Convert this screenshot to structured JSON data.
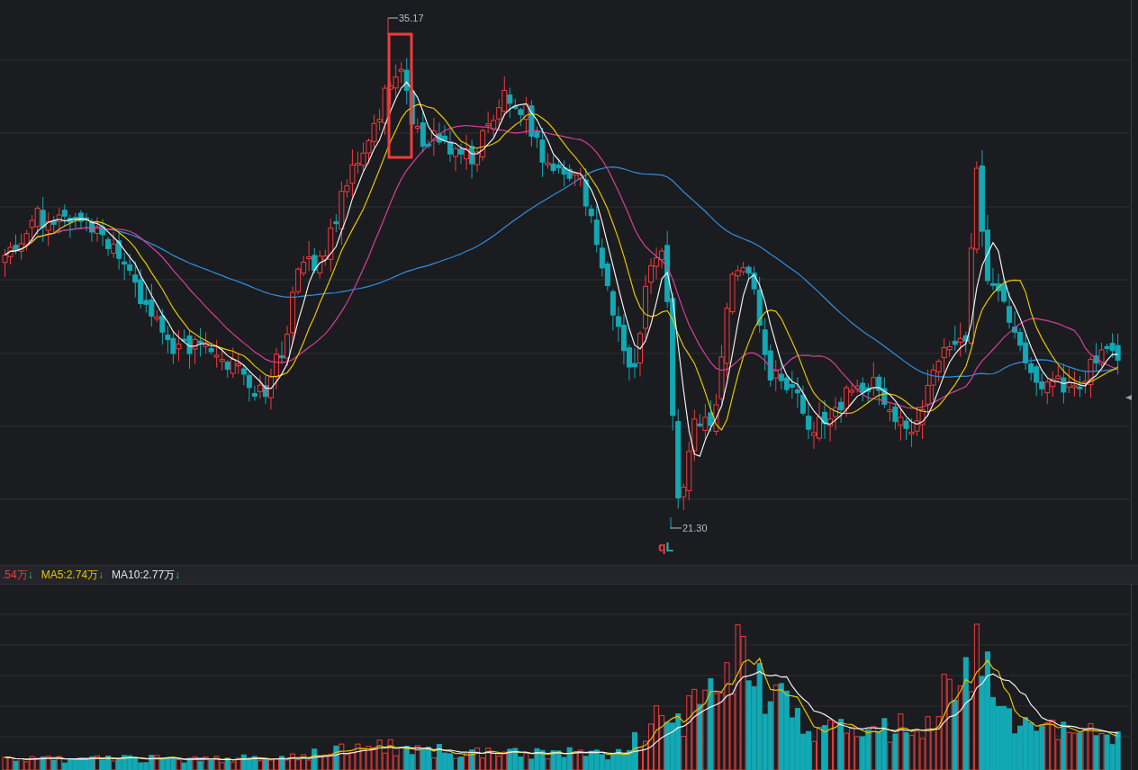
{
  "price_chart": {
    "high_label": "35.17",
    "low_label": "21.30",
    "signal_marks": [
      {
        "text": "q",
        "color": "#f03c3c"
      },
      {
        "text": "L",
        "color": "#1fb7c4"
      }
    ]
  },
  "volume_legend": [
    {
      "label": ".54万",
      "color": "#f03c3c",
      "arrow": "↓"
    },
    {
      "label": "MA5:2.74万",
      "color": "#e6c400",
      "arrow": "↓"
    },
    {
      "label": "MA10:2.77万",
      "color": "#dfe3ea",
      "arrow": "↓"
    }
  ]
}
